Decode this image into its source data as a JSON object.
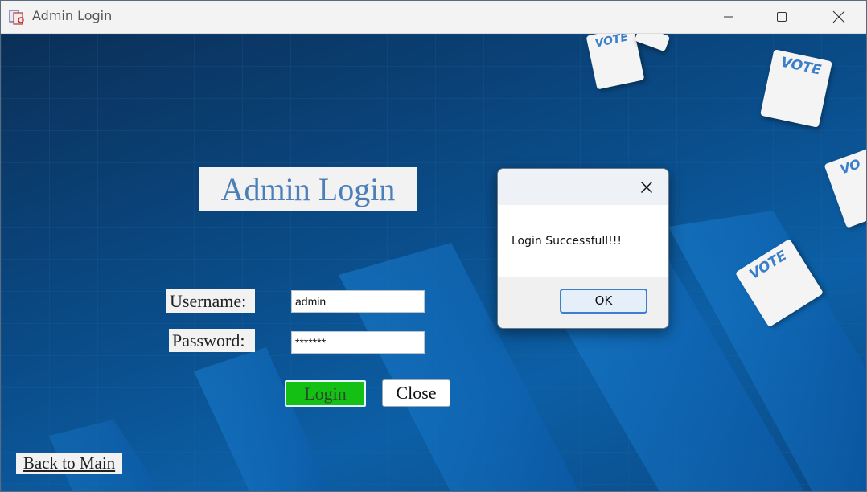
{
  "window": {
    "title": "Admin Login",
    "icon": "ballot-app-icon",
    "controls": [
      "minimize-icon",
      "maximize-icon",
      "close-icon"
    ]
  },
  "form": {
    "heading": "Admin Login",
    "username_label": "Username:",
    "username_value": "admin",
    "password_label": "Password:",
    "password_value": "*******",
    "login_button": "Login",
    "close_button": "Close",
    "back_link": "Back to Main"
  },
  "background": {
    "vote_badges": [
      "VOTE",
      "VOTE",
      "VOTE",
      "VO"
    ]
  },
  "dialog": {
    "message": "Login Successfull!!!",
    "ok_button": "OK"
  },
  "colors": {
    "login_button": "#13c013",
    "heading": "#4a7fb8",
    "dialog_ok_border": "#3a7fd0"
  }
}
